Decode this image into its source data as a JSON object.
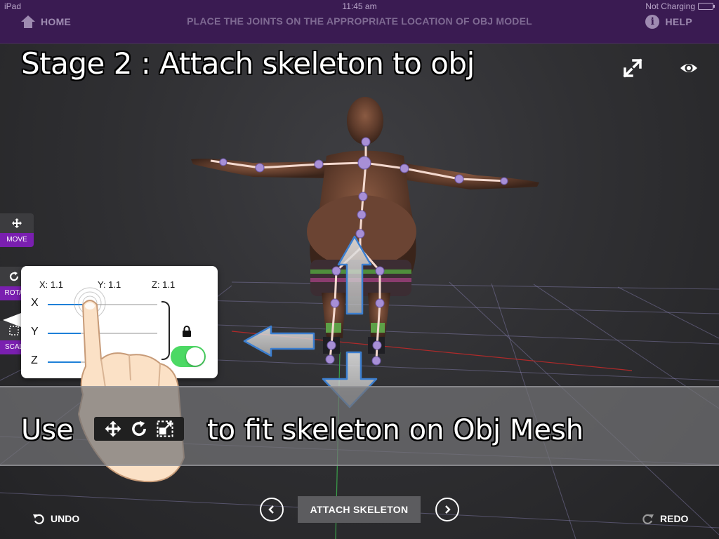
{
  "status_bar": {
    "carrier": "iPad",
    "time": "11:45 am",
    "battery": "Not Charging"
  },
  "header": {
    "home_label": "HOME",
    "instruction": "PLACE THE JOINTS ON THE APPROPRIATE LOCATION OF OBJ MODEL",
    "help_label": "HELP"
  },
  "viewport": {
    "stage_title": "Stage 2 : Attach skeleton to obj",
    "top_icons": [
      "expand-icon",
      "eye-icon"
    ]
  },
  "tools": {
    "move_label": "MOVE",
    "rotate_label": "ROTA",
    "scale_label": "SCAL"
  },
  "scale_panel": {
    "x_readout": "X:  1.1",
    "y_readout": "Y:  1.1",
    "z_readout": "Z:  1.1",
    "x_label": "X",
    "y_label": "Y",
    "z_label": "Z",
    "x_fill": 0.38,
    "y_fill": 0.3,
    "z_fill": 0.3,
    "lock_enabled": true
  },
  "hint": {
    "prefix": "Use",
    "suffix": "to fit skeleton on Obj Mesh",
    "icons": [
      "move-icon",
      "rotate-icon",
      "scale-icon"
    ]
  },
  "footer": {
    "undo_label": "UNDO",
    "attach_label": "ATTACH SKELETON",
    "redo_label": "REDO"
  },
  "colors": {
    "header_bg": "#3a1b52",
    "tool_accent": "#7a1fb0",
    "toggle_on": "#4cd964",
    "slider_fill": "#1e80d8",
    "joint": "#a78fd6"
  }
}
